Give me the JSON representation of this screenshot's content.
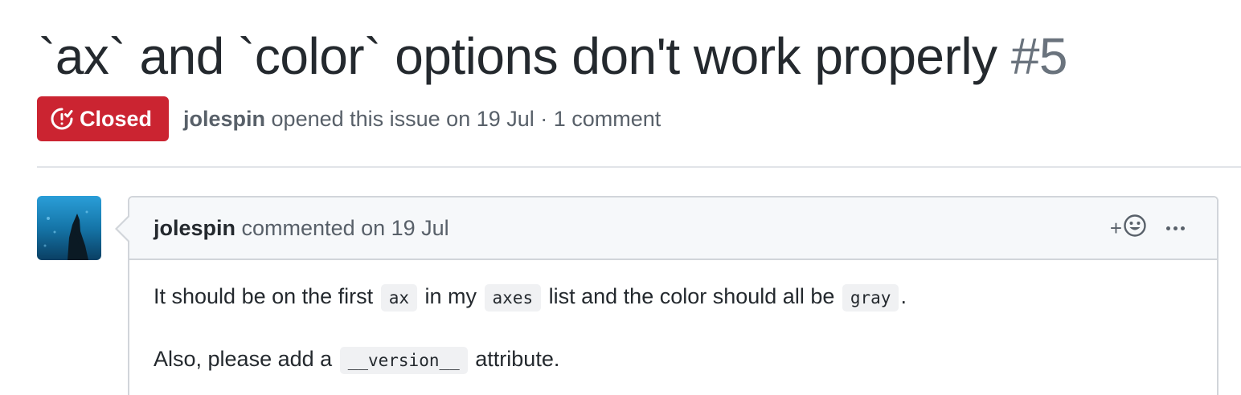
{
  "issue": {
    "title": "`ax` and `color` options don't work properly",
    "number": "#5",
    "state": "Closed",
    "author": "jolespin",
    "opened_text": "opened this issue on 19 Jul · 1 comment"
  },
  "comment": {
    "author": "jolespin",
    "action_text": "commented on 19 Jul",
    "reaction_plus": "+",
    "body": {
      "p1_text1": "It should be on the first",
      "p1_code1": "ax",
      "p1_text2": "in my",
      "p1_code2": "axes",
      "p1_text3": "list and the color should all be",
      "p1_code3": "gray",
      "p1_text4": ".",
      "p2_text1": "Also, please add a",
      "p2_code1": "__version__",
      "p2_text2": "attribute."
    }
  },
  "colors": {
    "closed_badge": "#cb2431",
    "text_primary": "#24292e",
    "text_muted": "#586069",
    "border": "#d1d5da",
    "header_bg": "#f6f8fa"
  },
  "icons": {
    "state": "issue-closed-icon",
    "reaction": "smiley-icon",
    "more": "kebab-horizontal-icon"
  }
}
